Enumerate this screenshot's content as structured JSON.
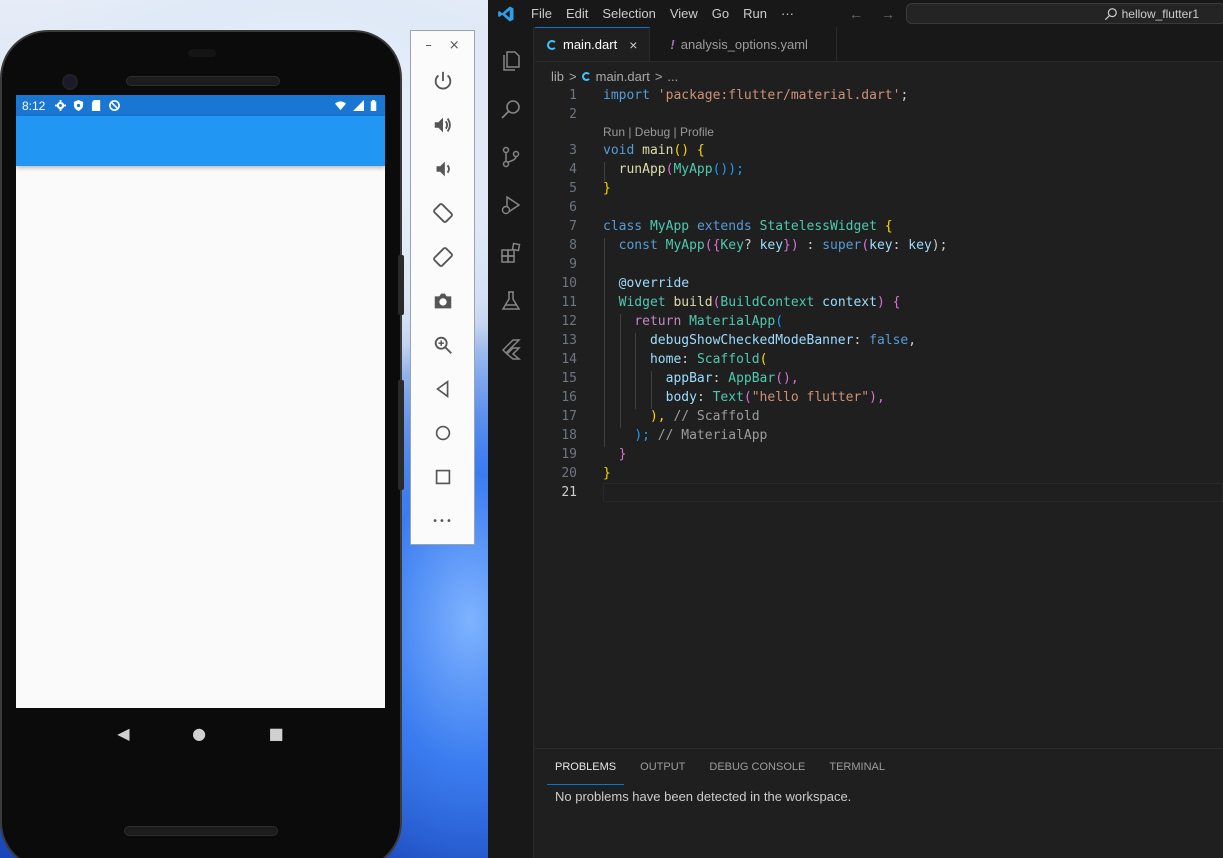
{
  "phone": {
    "status_time": "8:12",
    "nav": {
      "back": "◀",
      "home": "●",
      "recents": "■"
    }
  },
  "emulator_toolbar": {
    "minimize": "–",
    "close": "×",
    "more": "•••"
  },
  "vscode": {
    "menu": [
      "File",
      "Edit",
      "Selection",
      "View",
      "Go",
      "Run",
      "···"
    ],
    "search": "hellow_flutter1",
    "tabs": [
      {
        "label": "main.dart",
        "close": "×"
      },
      {
        "label": "analysis_options.yaml"
      }
    ],
    "breadcrumb": {
      "folder": "lib",
      "sep": ">",
      "file": "main.dart",
      "more": "..."
    },
    "codelens": "Run | Debug | Profile",
    "line_numbers": [
      "1",
      "2",
      "3",
      "4",
      "5",
      "6",
      "7",
      "8",
      "9",
      "10",
      "11",
      "12",
      "13",
      "14",
      "15",
      "16",
      "17",
      "18",
      "19",
      "20",
      "21"
    ],
    "code": {
      "l1": {
        "kw": "import",
        "str": "'package:flutter/material.dart'",
        "end": ";"
      },
      "l3": {
        "kw": "void",
        "fn": "main",
        "rest": "() {"
      },
      "l4": {
        "fn": "runApp",
        "cls": "MyApp",
        "rest": "());"
      },
      "l5": "}",
      "l7": {
        "kw": "class",
        "cls1": "MyApp",
        "kw2": "extends",
        "cls2": "StatelessWidget",
        "rest": "{"
      },
      "l8": {
        "kw": "const",
        "cls": "MyApp",
        "open": "({",
        "cls2": "Key",
        "q": "? ",
        "var": "key",
        "close": "})",
        "sep": " : ",
        "kw2": "super",
        "var2": "key",
        "var3": "key",
        "end": ");"
      },
      "l10": "@override",
      "l11": {
        "cls": "Widget",
        "fn": "build",
        "cls2": "BuildContext",
        "var": "context",
        "rest": ") {"
      },
      "l12": {
        "kw": "return",
        "cls": "MaterialApp",
        "rest": "("
      },
      "l13": {
        "var": "debugShowCheckedModeBanner",
        "kw": "false",
        "rest": ","
      },
      "l14": {
        "var": "home",
        "cls": "Scaffold",
        "rest": "("
      },
      "l15": {
        "var": "appBar",
        "cls": "AppBar",
        "rest": "(),"
      },
      "l16": {
        "var": "body",
        "cls": "Text",
        "str": "\"hello flutter\"",
        "rest": "),"
      },
      "l17": {
        "rest": "), ",
        "com": "// Scaffold"
      },
      "l18": {
        "rest": "); ",
        "com": "// MaterialApp"
      },
      "l19": "}",
      "l20": "}"
    },
    "panel": {
      "tabs": [
        "PROBLEMS",
        "OUTPUT",
        "DEBUG CONSOLE",
        "TERMINAL"
      ],
      "message": "No problems have been detected in the workspace."
    }
  }
}
